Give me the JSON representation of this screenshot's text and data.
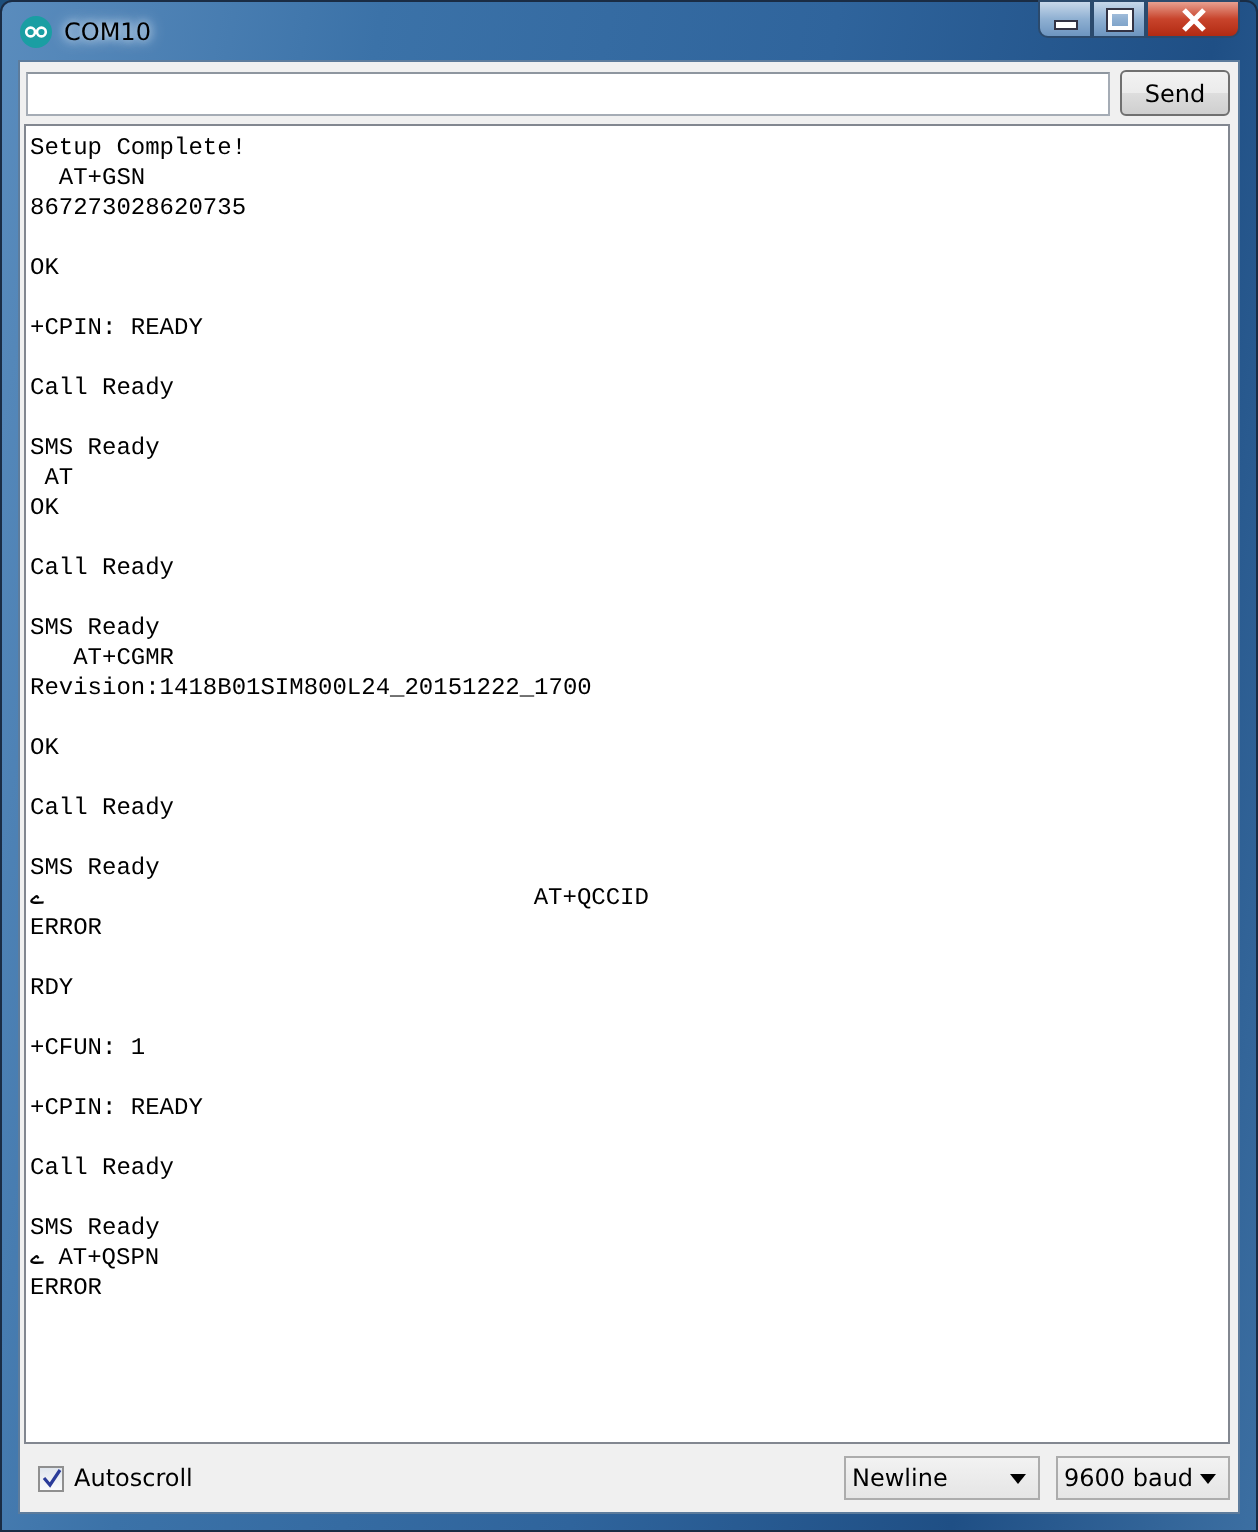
{
  "window": {
    "title": "COM10"
  },
  "send_button": "Send",
  "output": "Setup Complete!\n  AT+GSN\n867273028620735\n\nOK\n\n+CPIN: READY\n\nCall Ready\n\nSMS Ready\n AT\nOK\n\nCall Ready\n\nSMS Ready\n   AT+CGMR\nRevision:1418B01SIM800L24_20151222_1700\n\nOK\n\nCall Ready\n\nSMS Ready\nے                                  AT+QCCID\nERROR\n\nRDY\n\n+CFUN: 1\n\n+CPIN: READY\n\nCall Ready\n\nSMS Ready\nے AT+QSPN\nERROR",
  "autoscroll": {
    "label": "Autoscroll",
    "checked": true
  },
  "line_ending": "Newline",
  "baud": "9600 baud"
}
